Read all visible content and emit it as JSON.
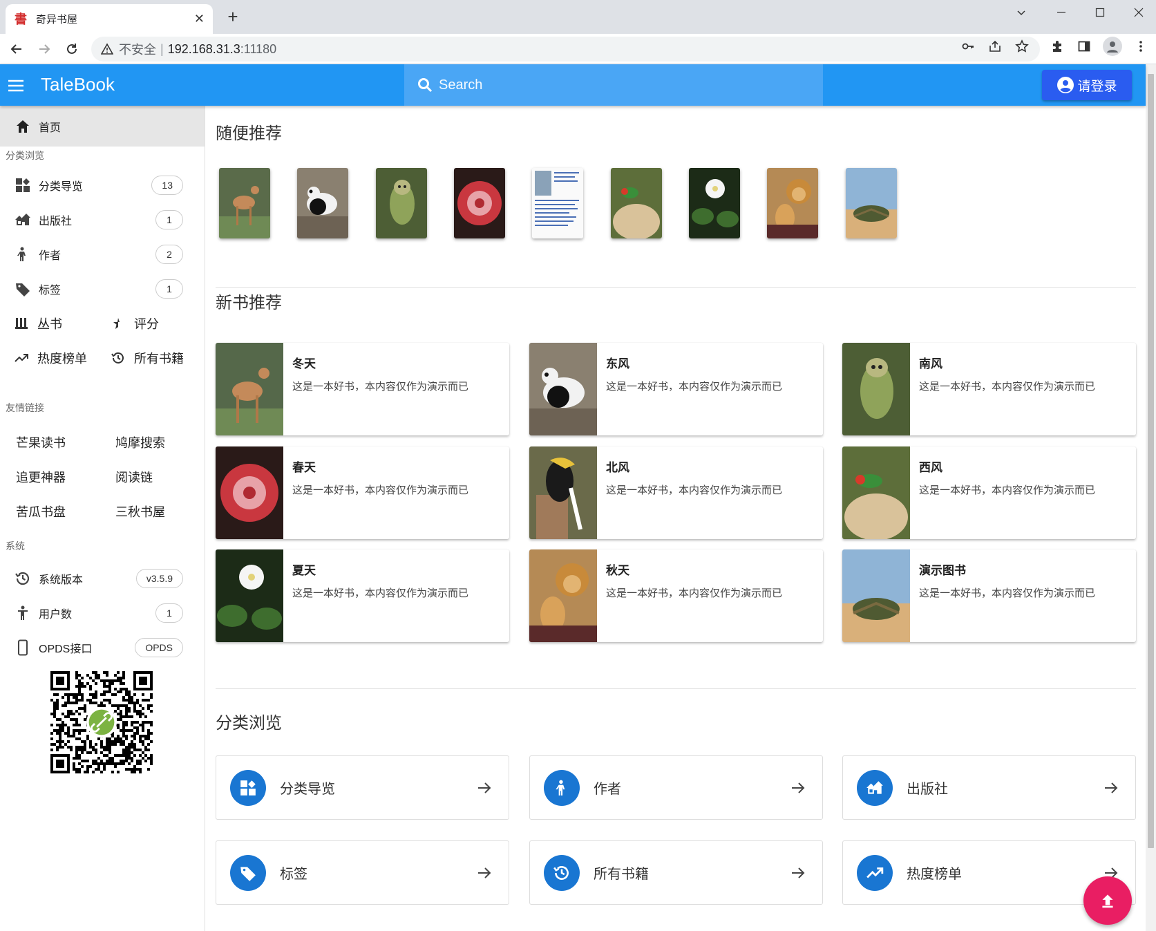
{
  "browser": {
    "tab_title": "奇异书屋",
    "tab_favicon": "書",
    "insecure_label": "不安全",
    "url_host": "192.168.31.3",
    "url_port": ":11180"
  },
  "appbar": {
    "brand": "TaleBook",
    "search_placeholder": "Search",
    "login_label": "请登录",
    "color": "#2196f3"
  },
  "sidebar": {
    "home": "首页",
    "browse_header": "分类浏览",
    "browse_items": [
      {
        "label": "分类导览",
        "count": "13",
        "icon": "category-icon"
      },
      {
        "label": "出版社",
        "count": "1",
        "icon": "publisher-icon"
      },
      {
        "label": "作者",
        "count": "2",
        "icon": "author-icon"
      },
      {
        "label": "标签",
        "count": "1",
        "icon": "tag-icon"
      }
    ],
    "series": "丛书",
    "rating": "评分",
    "hot": "热度榜单",
    "all_books": "所有书籍",
    "links_header": "友情链接",
    "links": [
      "芒果读书",
      "鸠摩搜索",
      "追更神器",
      "阅读链",
      "苦瓜书盘",
      "三秋书屋"
    ],
    "system_header": "系统",
    "system_items": [
      {
        "label": "系统版本",
        "value": "v3.5.9"
      },
      {
        "label": "用户数",
        "value": "1"
      },
      {
        "label": "OPDS接口",
        "value": "OPDS"
      }
    ]
  },
  "main": {
    "random_title": "随便推荐",
    "new_title": "新书推荐",
    "category_title": "分类浏览",
    "books": [
      {
        "title": "冬天",
        "desc": "这是一本好书，本内容仅作为演示而已"
      },
      {
        "title": "东风",
        "desc": "这是一本好书，本内容仅作为演示而已"
      },
      {
        "title": "南风",
        "desc": "这是一本好书，本内容仅作为演示而已"
      },
      {
        "title": "春天",
        "desc": "这是一本好书，本内容仅作为演示而已"
      },
      {
        "title": "北风",
        "desc": "这是一本好书，本内容仅作为演示而已"
      },
      {
        "title": "西风",
        "desc": "这是一本好书，本内容仅作为演示而已"
      },
      {
        "title": "夏天",
        "desc": "这是一本好书，本内容仅作为演示而已"
      },
      {
        "title": "秋天",
        "desc": "这是一本好书，本内容仅作为演示而已"
      },
      {
        "title": "演示图书",
        "desc": "这是一本好书，本内容仅作为演示而已"
      }
    ],
    "categories": [
      {
        "label": "分类导览",
        "icon": "category-icon"
      },
      {
        "label": "作者",
        "icon": "author-icon"
      },
      {
        "label": "出版社",
        "icon": "publisher-icon"
      },
      {
        "label": "标签",
        "icon": "tag-icon"
      },
      {
        "label": "所有书籍",
        "icon": "history-icon"
      },
      {
        "label": "热度榜单",
        "icon": "trending-icon"
      }
    ]
  }
}
